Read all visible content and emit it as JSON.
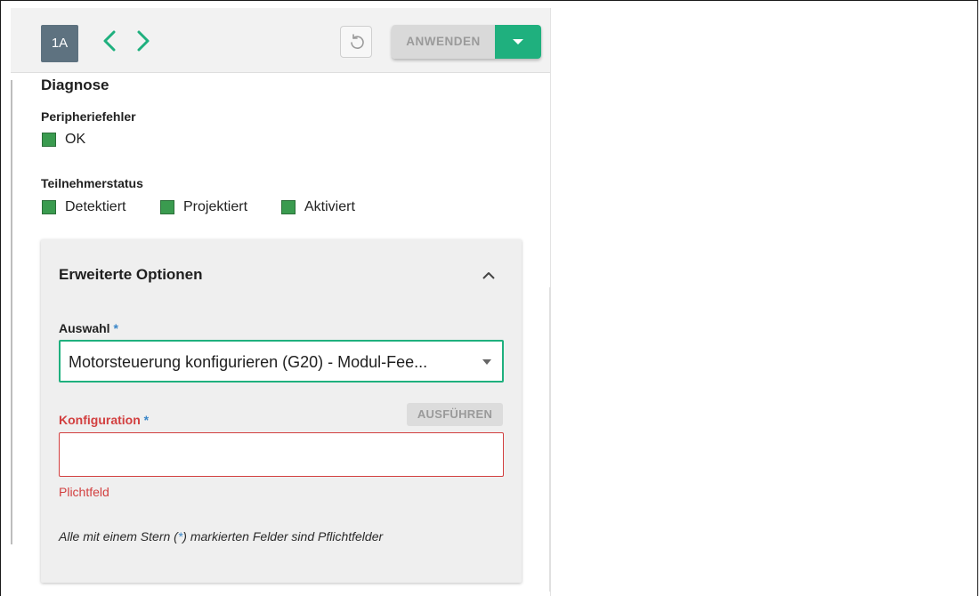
{
  "toolbar": {
    "badge": "1A",
    "apply_label": "ANWENDEN"
  },
  "icons": {
    "prev": "chevron-left-icon",
    "next": "chevron-right-icon",
    "undo": "undo-icon",
    "dropdown": "caret-down-icon",
    "collapse": "chevron-up-icon"
  },
  "colors": {
    "accent": "#1fb07e",
    "status_ok": "#3a9b4f",
    "error": "#d23f3f",
    "required_star": "#3a86c8",
    "badge_bg": "#5e7280"
  },
  "diagnose": {
    "heading": "Diagnose",
    "peripheral_label": "Peripheriefehler",
    "peripheral_status": "OK",
    "participant_label": "Teilnehmerstatus",
    "participant_states": [
      "Detektiert",
      "Projektiert",
      "Aktiviert"
    ]
  },
  "advanced": {
    "title": "Erweiterte Optionen",
    "selection_label": "Auswahl",
    "required_mark": "*",
    "selection_value": "Motorsteuerung konfigurieren (G20) - Modul-Fee...",
    "execute_label": "AUSFÜHREN",
    "config_label": "Konfiguration",
    "config_value": "",
    "error_text": "Plichtfeld",
    "note_prefix": "Alle mit einem Stern (",
    "note_star": "*",
    "note_suffix": ") markierten Felder sind Pflichtfelder"
  }
}
